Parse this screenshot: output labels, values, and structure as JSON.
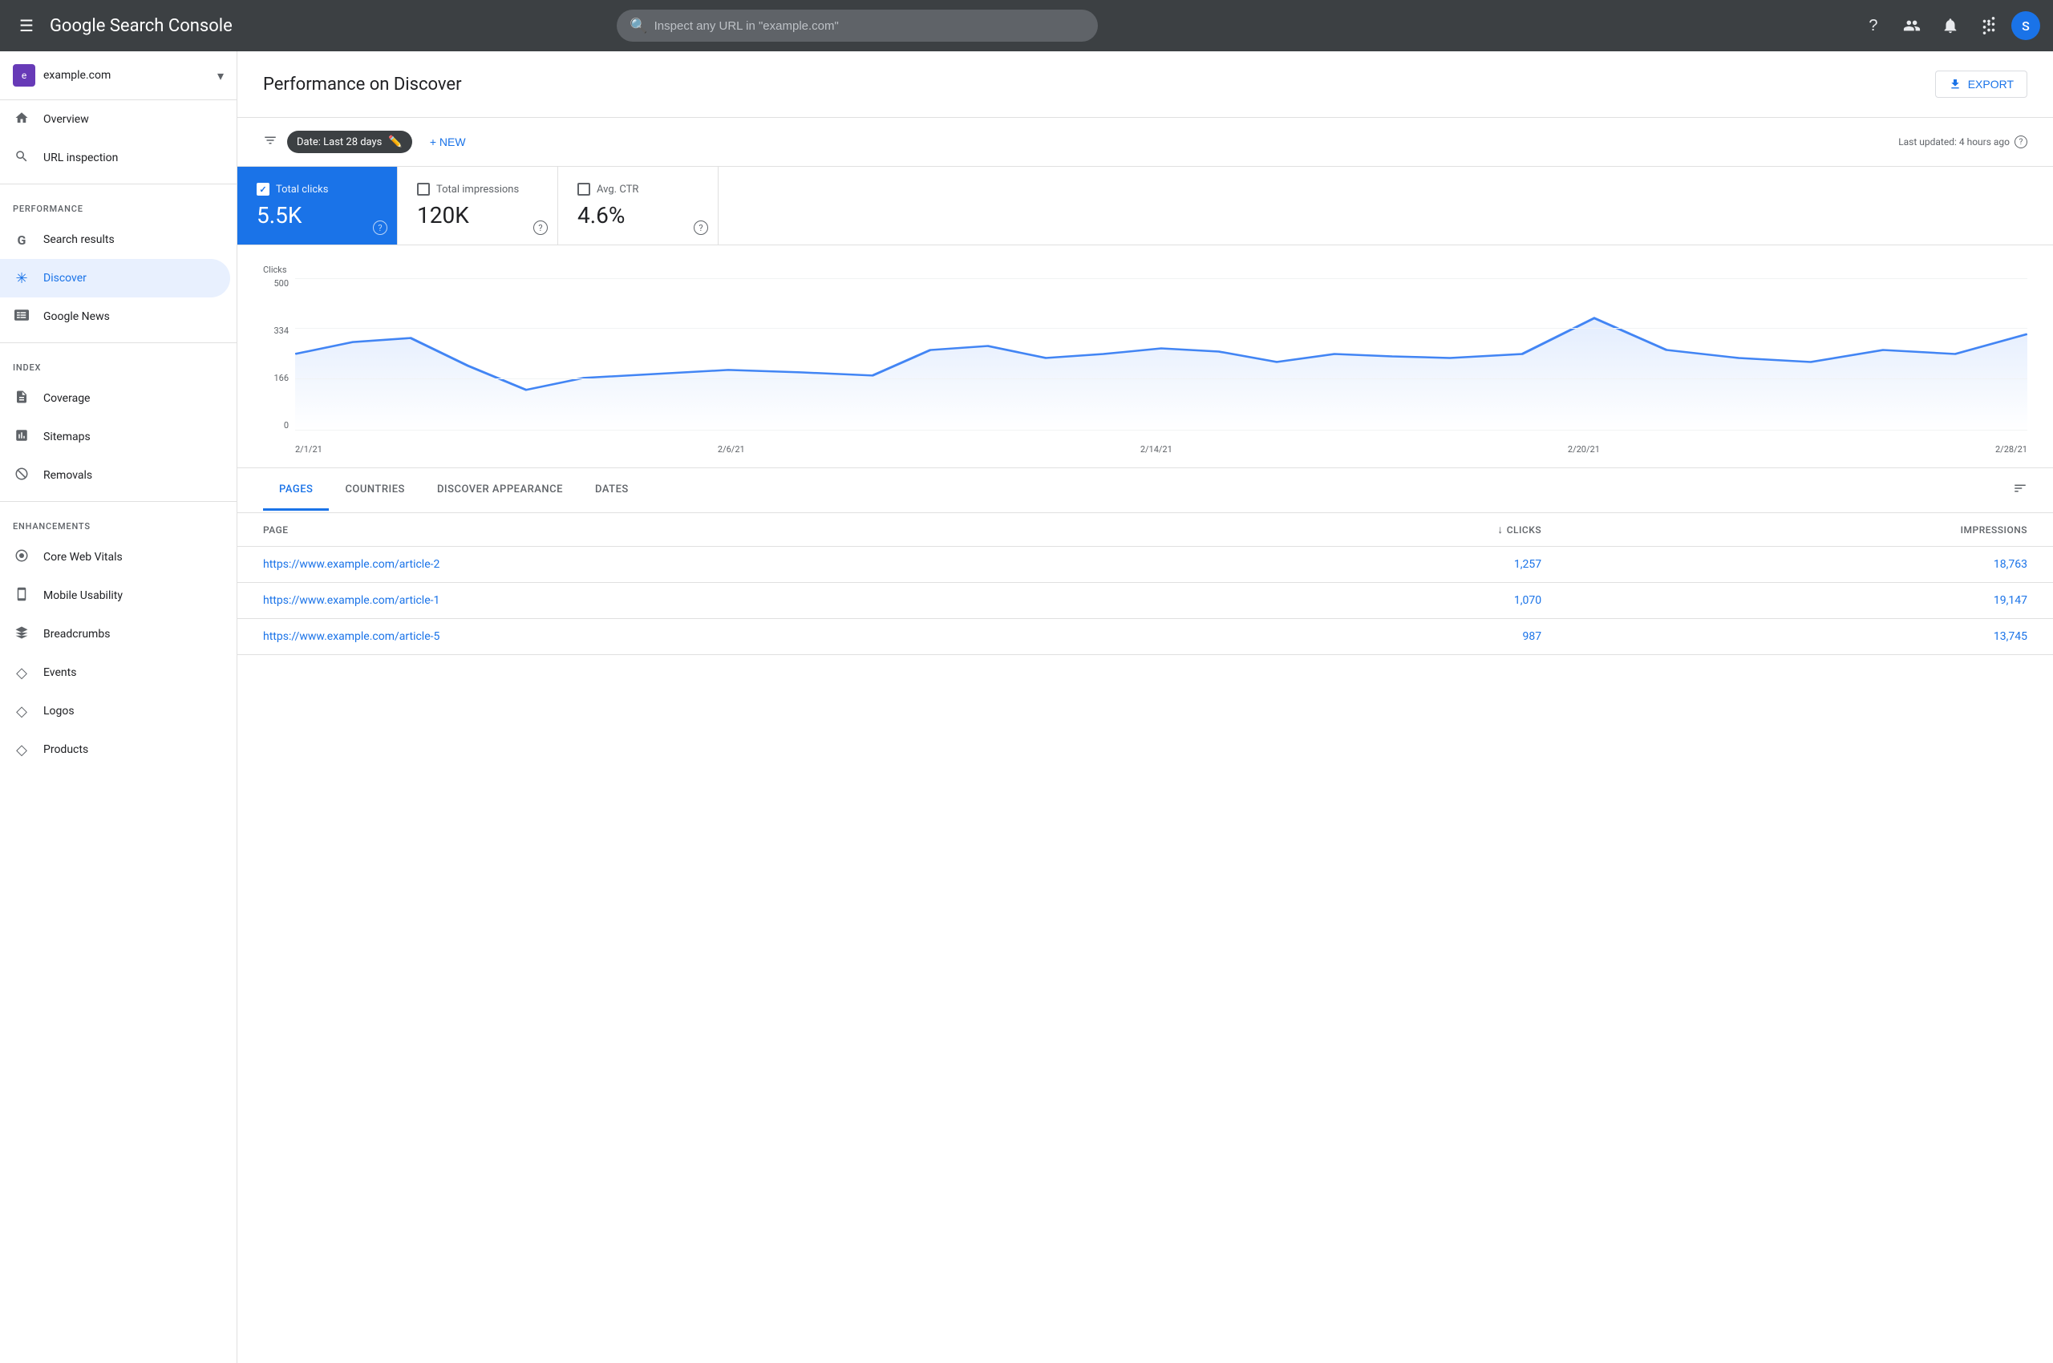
{
  "app": {
    "name": "Google Search Console",
    "search_placeholder": "Inspect any URL in \"example.com\""
  },
  "topnav": {
    "avatar_letter": "S",
    "help_icon": "?",
    "accounts_icon": "👤",
    "bell_icon": "🔔",
    "grid_icon": "⋮⋮⋮"
  },
  "sidebar": {
    "property": {
      "name": "example.com",
      "icon_letter": "e"
    },
    "nav_items": [
      {
        "id": "overview",
        "label": "Overview",
        "icon": "🏠"
      },
      {
        "id": "url-inspection",
        "label": "URL inspection",
        "icon": "🔍"
      }
    ],
    "sections": [
      {
        "header": "Performance",
        "items": [
          {
            "id": "search-results",
            "label": "Search results",
            "icon": "G"
          },
          {
            "id": "discover",
            "label": "Discover",
            "icon": "✳",
            "active": true
          },
          {
            "id": "google-news",
            "label": "Google News",
            "icon": "📰"
          }
        ]
      },
      {
        "header": "Index",
        "items": [
          {
            "id": "coverage",
            "label": "Coverage",
            "icon": "📄"
          },
          {
            "id": "sitemaps",
            "label": "Sitemaps",
            "icon": "📊"
          },
          {
            "id": "removals",
            "label": "Removals",
            "icon": "🚫"
          }
        ]
      },
      {
        "header": "Enhancements",
        "items": [
          {
            "id": "core-web-vitals",
            "label": "Core Web Vitals",
            "icon": "⊙"
          },
          {
            "id": "mobile-usability",
            "label": "Mobile Usability",
            "icon": "📱"
          },
          {
            "id": "breadcrumbs",
            "label": "Breadcrumbs",
            "icon": "◇"
          },
          {
            "id": "events",
            "label": "Events",
            "icon": "◇"
          },
          {
            "id": "logos",
            "label": "Logos",
            "icon": "◇"
          },
          {
            "id": "products",
            "label": "Products",
            "icon": "◇"
          }
        ]
      }
    ]
  },
  "main": {
    "title": "Performance on Discover",
    "export_label": "EXPORT",
    "filter_bar": {
      "date_label": "Date: Last 28 days",
      "new_label": "+ NEW",
      "last_updated": "Last updated: 4 hours ago"
    },
    "metrics": [
      {
        "id": "total-clicks",
        "label": "Total clicks",
        "value": "5.5K",
        "active": true
      },
      {
        "id": "total-impressions",
        "label": "Total impressions",
        "value": "120K",
        "active": false
      },
      {
        "id": "avg-ctr",
        "label": "Avg. CTR",
        "value": "4.6%",
        "active": false
      }
    ],
    "chart": {
      "y_label": "Clicks",
      "y_ticks": [
        "500",
        "334",
        "166",
        "0"
      ],
      "x_ticks": [
        "2/1/21",
        "2/6/21",
        "2/14/21",
        "2/20/21",
        "2/28/21"
      ],
      "line_color": "#4285f4"
    },
    "tabs": [
      {
        "id": "pages",
        "label": "PAGES",
        "active": true
      },
      {
        "id": "countries",
        "label": "COUNTRIES",
        "active": false
      },
      {
        "id": "discover-appearance",
        "label": "DISCOVER APPEARANCE",
        "active": false
      },
      {
        "id": "dates",
        "label": "DATES",
        "active": false
      }
    ],
    "table": {
      "columns": [
        {
          "id": "page",
          "label": "Page",
          "align": "left"
        },
        {
          "id": "clicks",
          "label": "Clicks",
          "align": "right",
          "sorted": true
        },
        {
          "id": "impressions",
          "label": "Impressions",
          "align": "right"
        }
      ],
      "rows": [
        {
          "page": "https://www.example.com/article-2",
          "clicks": "1,257",
          "impressions": "18,763"
        },
        {
          "page": "https://www.example.com/article-1",
          "clicks": "1,070",
          "impressions": "19,147"
        },
        {
          "page": "https://www.example.com/article-5",
          "clicks": "987",
          "impressions": "13,745"
        }
      ]
    }
  }
}
